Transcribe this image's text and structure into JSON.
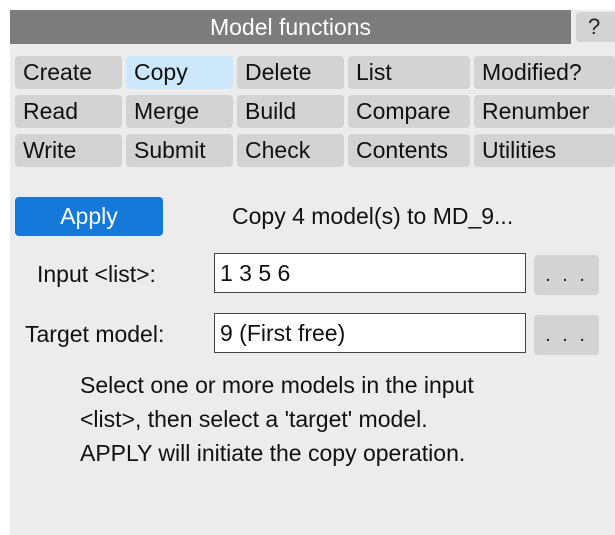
{
  "panel": {
    "title": "Model functions",
    "help_label": "?"
  },
  "menu": {
    "rows": [
      [
        "Create",
        "Copy",
        "Delete",
        "List",
        "Modified?"
      ],
      [
        "Read",
        "Merge",
        "Build",
        "Compare",
        "Renumber"
      ],
      [
        "Write",
        "Submit",
        "Check",
        "Contents",
        "Utilities"
      ]
    ],
    "selected": "Copy"
  },
  "apply": {
    "label": "Apply",
    "status": "Copy 4 model(s) to MD_9..."
  },
  "input_list": {
    "label": "Input <list>:",
    "value": "1 3 5 6",
    "browse_label": ". . ."
  },
  "target_model": {
    "label": "Target model:",
    "value": "9 (First free)",
    "browse_label": ". . ."
  },
  "help_text": {
    "line1": "Select one or more models in the input",
    "line2": "<list>, then select a 'target' model.",
    "line3": "APPLY will initiate the copy operation."
  },
  "colors": {
    "panel_bg": "#ececec",
    "title_bg": "#7c7c7c",
    "button_bg": "#d3d3d3",
    "selected_bg": "#cde8fb",
    "apply_bg": "#1479d9"
  }
}
